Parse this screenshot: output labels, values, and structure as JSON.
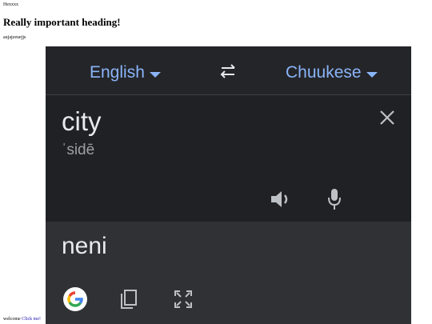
{
  "page": {
    "small_text": "Hexxxx",
    "heading": "Really important heading!",
    "paragraph": "aujajzeuejjs",
    "welcome_text": "welcome",
    "link_text": "Click me!"
  },
  "translator": {
    "source_language": "English",
    "target_language": "Chuukese",
    "source_text": "city",
    "pronunciation": "ˈsidē",
    "output_text": "neni",
    "icons": [
      "caret-down-icon",
      "swap-icon",
      "close-icon",
      "speaker-icon",
      "mic-icon",
      "google-logo-icon",
      "copy-icon",
      "fullscreen-icon"
    ],
    "colors": {
      "background": "#202124",
      "accent": "#8ab4f8",
      "output_panel": "#303134"
    }
  }
}
